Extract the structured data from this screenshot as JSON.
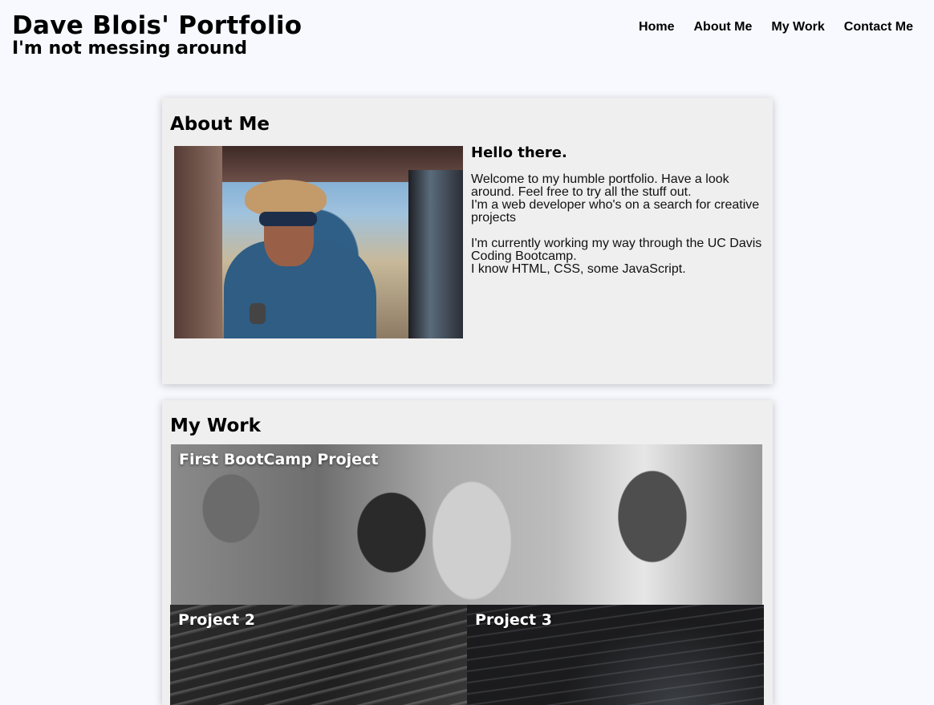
{
  "header": {
    "title": "Dave Blois' Portfolio",
    "subtitle": "I'm not messing around"
  },
  "nav": {
    "items": [
      "Home",
      "About Me",
      "My Work",
      "Contact Me"
    ]
  },
  "about": {
    "heading": "About Me",
    "greeting": "Hello there.",
    "paragraph1": [
      "Welcome to my humble portfolio. Have a look around. Feel free to try all the stuff out.",
      "I'm a web developer who's on a search for creative projects"
    ],
    "paragraph2": [
      "I'm currently working my way through the UC Davis Coding Bootcamp.",
      "I know HTML, CSS, some JavaScript."
    ]
  },
  "work": {
    "heading": "My Work",
    "projects": [
      "First BootCamp Project",
      "Project 2",
      "Project 3"
    ]
  }
}
